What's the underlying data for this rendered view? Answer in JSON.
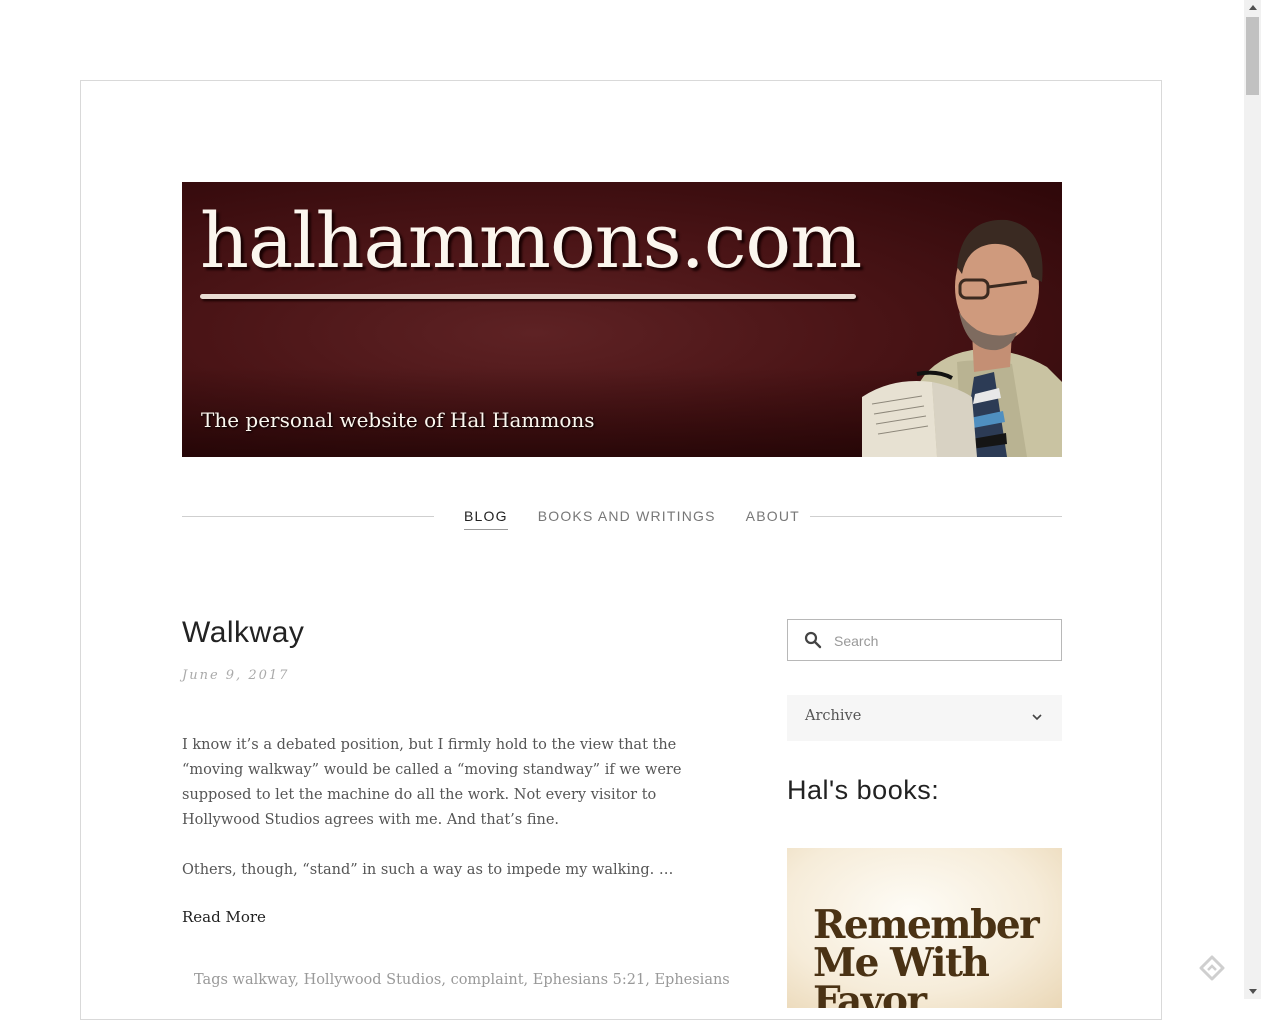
{
  "header": {
    "banner_title": "halhammons.com",
    "banner_tagline": "The personal website of Hal Hammons"
  },
  "nav": {
    "items": [
      {
        "label": "BLOG",
        "active": true
      },
      {
        "label": "BOOKS AND WRITINGS",
        "active": false
      },
      {
        "label": "ABOUT",
        "active": false
      }
    ]
  },
  "post": {
    "title": "Walkway",
    "date": "June 9, 2017",
    "paragraphs": [
      "I know it’s a debated position, but I firmly hold to the view that the “moving walkway” would be called a “moving standway” if we were supposed to let the machine do all the work.  Not every visitor to Hollywood Studios agrees with me.  And that’s fine.",
      "Others, though, “stand” in such a way as to impede my walking.  …"
    ],
    "read_more": "Read More",
    "tags_label": "Tags",
    "tags": [
      "walkway",
      "Hollywood Studios",
      "complaint",
      "Ephesians 5:21",
      "Ephesians"
    ]
  },
  "sidebar": {
    "search_placeholder": "Search",
    "archive_label": "Archive",
    "books_heading": "Hal's books:",
    "book_cover_title": "Remember Me With Favor"
  },
  "colors": {
    "banner_bg": "#4a1416",
    "nav_active": "#222222",
    "nav_inactive": "#777777",
    "body_text": "#555555"
  },
  "icons": [
    "search-icon",
    "chevron-down-icon",
    "feedly-icon"
  ]
}
